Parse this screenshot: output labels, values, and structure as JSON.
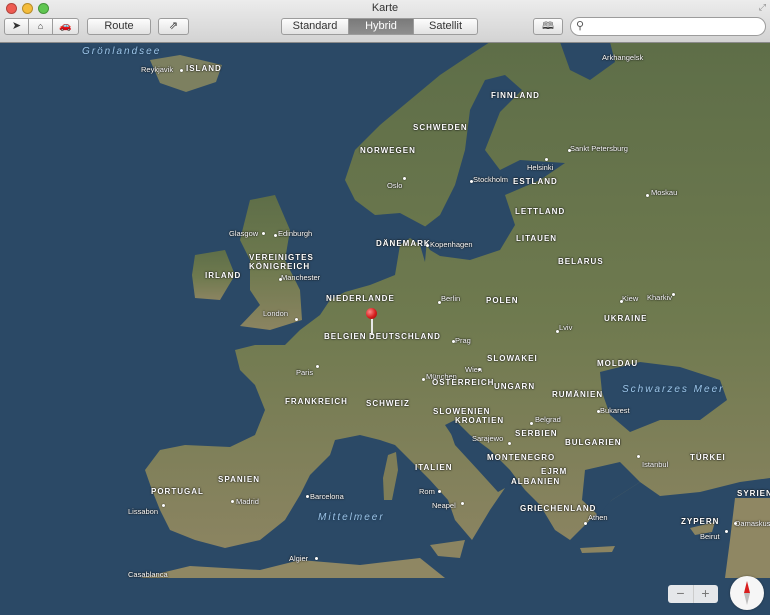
{
  "window": {
    "title": "Karte"
  },
  "toolbar": {
    "route_label": "Route",
    "map_types": [
      "Standard",
      "Hybrid",
      "Satellit"
    ],
    "selected_map_type": "Hybrid",
    "search_placeholder": "",
    "icons": [
      "location-arrow-icon",
      "3d-buildings-icon",
      "traffic-car-icon",
      "share-icon",
      "bookmarks-icon",
      "search-icon",
      "fullscreen-icon"
    ]
  },
  "colors": {
    "sea": "#2b4966",
    "land_north": "#5e6e48",
    "land_south": "#8b8461",
    "pin": "#d61d1d"
  },
  "map": {
    "labels": [
      {
        "text": "Grönlandsee",
        "kind": "ocean"
      },
      {
        "text": "Reykjavik",
        "kind": "city"
      },
      {
        "text": "ISLAND",
        "kind": "country"
      },
      {
        "text": "Arkhangelsk",
        "kind": "city"
      },
      {
        "text": "FINNLAND",
        "kind": "country"
      },
      {
        "text": "SCHWEDEN",
        "kind": "country"
      },
      {
        "text": "NORWEGEN",
        "kind": "country"
      },
      {
        "text": "Sankt Petersburg",
        "kind": "city"
      },
      {
        "text": "Helsinki",
        "kind": "city"
      },
      {
        "text": "Oslo",
        "kind": "city"
      },
      {
        "text": "Stockholm",
        "kind": "city"
      },
      {
        "text": "ESTLAND",
        "kind": "country"
      },
      {
        "text": "Moskau",
        "kind": "city"
      },
      {
        "text": "LETTLAND",
        "kind": "country"
      },
      {
        "text": "Glasgow",
        "kind": "city"
      },
      {
        "text": "Edinburgh",
        "kind": "city"
      },
      {
        "text": "DÄNEMARK",
        "kind": "country"
      },
      {
        "text": "Kopenhagen",
        "kind": "city"
      },
      {
        "text": "LITAUEN",
        "kind": "country"
      },
      {
        "text": "VEREINIGTES",
        "kind": "country"
      },
      {
        "text": "KÖNIGREICH",
        "kind": "country"
      },
      {
        "text": "BELARUS",
        "kind": "country"
      },
      {
        "text": "IRLAND",
        "kind": "country"
      },
      {
        "text": "Manchester",
        "kind": "city"
      },
      {
        "text": "NIEDERLANDE",
        "kind": "country"
      },
      {
        "text": "Berlin",
        "kind": "city"
      },
      {
        "text": "POLEN",
        "kind": "country"
      },
      {
        "text": "Kiew",
        "kind": "city"
      },
      {
        "text": "Kharkiv",
        "kind": "city"
      },
      {
        "text": "London",
        "kind": "city"
      },
      {
        "text": "UKRAINE",
        "kind": "country"
      },
      {
        "text": "Lviv",
        "kind": "city"
      },
      {
        "text": "BELGIEN",
        "kind": "country"
      },
      {
        "text": "DEUTSCHLAND",
        "kind": "country"
      },
      {
        "text": "Prag",
        "kind": "city"
      },
      {
        "text": "SLOWAKEI",
        "kind": "country"
      },
      {
        "text": "MOLDAU",
        "kind": "country"
      },
      {
        "text": "Paris",
        "kind": "city"
      },
      {
        "text": "Wien",
        "kind": "city"
      },
      {
        "text": "München",
        "kind": "city"
      },
      {
        "text": "ÖSTERREICH",
        "kind": "country"
      },
      {
        "text": "UNGARN",
        "kind": "country"
      },
      {
        "text": "RUMÄNIEN",
        "kind": "country"
      },
      {
        "text": "Schwarzes Meer",
        "kind": "ocean"
      },
      {
        "text": "FRANKREICH",
        "kind": "country"
      },
      {
        "text": "SCHWEIZ",
        "kind": "country"
      },
      {
        "text": "SLOWENIEN",
        "kind": "country"
      },
      {
        "text": "KROATIEN",
        "kind": "country"
      },
      {
        "text": "Bukarest",
        "kind": "city"
      },
      {
        "text": "Belgrad",
        "kind": "city"
      },
      {
        "text": "Sarajewo",
        "kind": "city"
      },
      {
        "text": "SERBIEN",
        "kind": "country"
      },
      {
        "text": "BULGARIEN",
        "kind": "country"
      },
      {
        "text": "TÜRKEI",
        "kind": "country"
      },
      {
        "text": "MONTENEGRO",
        "kind": "country"
      },
      {
        "text": "ITALIEN",
        "kind": "country"
      },
      {
        "text": "Istanbul",
        "kind": "city"
      },
      {
        "text": "EJRM",
        "kind": "country"
      },
      {
        "text": "SPANIEN",
        "kind": "country"
      },
      {
        "text": "ALBANIEN",
        "kind": "country"
      },
      {
        "text": "PORTUGAL",
        "kind": "country"
      },
      {
        "text": "Barcelona",
        "kind": "city"
      },
      {
        "text": "Madrid",
        "kind": "city"
      },
      {
        "text": "Rom",
        "kind": "city"
      },
      {
        "text": "SYRIEN",
        "kind": "country"
      },
      {
        "text": "Neapel",
        "kind": "city"
      },
      {
        "text": "Lissabon",
        "kind": "city"
      },
      {
        "text": "GRIECHENLAND",
        "kind": "country"
      },
      {
        "text": "Mittelmeer",
        "kind": "ocean"
      },
      {
        "text": "Athen",
        "kind": "city"
      },
      {
        "text": "ZYPERN",
        "kind": "country"
      },
      {
        "text": "Damaskus",
        "kind": "city"
      },
      {
        "text": "Beirut",
        "kind": "city"
      },
      {
        "text": "Algier",
        "kind": "city"
      },
      {
        "text": "Casablanca",
        "kind": "city"
      }
    ],
    "zoom_out_label": "−",
    "zoom_in_label": "+"
  }
}
